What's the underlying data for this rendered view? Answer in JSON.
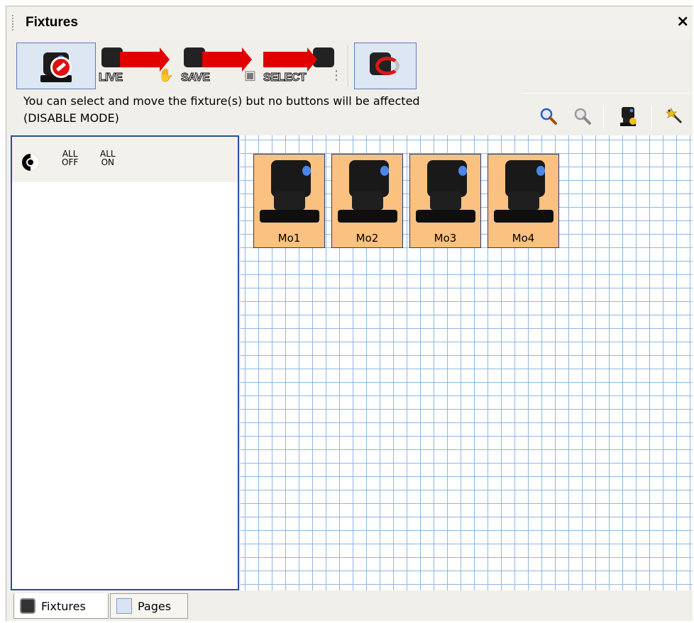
{
  "panel": {
    "title": "Fixtures",
    "close_glyph": "×"
  },
  "toolbar": {
    "buttons": [
      {
        "name": "disable-mode",
        "icon": "fixture-disabled-icon",
        "pressed": true
      },
      {
        "name": "live-mode",
        "icon": "live-mode-icon",
        "word": "LIVE",
        "tag": "hand"
      },
      {
        "name": "save-mode",
        "icon": "save-mode-icon",
        "word": "SAVE",
        "tag": "floppy"
      },
      {
        "name": "select-mode",
        "icon": "select-mode-icon",
        "word": "SELECT",
        "tag": "marquee"
      },
      {
        "name": "magnet-mode",
        "icon": "magnet-icon",
        "pressed": true
      }
    ]
  },
  "info": {
    "line1": "You can select and move the fixture(s) but no buttons will be affected",
    "line2": "(DISABLE MODE)"
  },
  "zoombar": {
    "icons": [
      "zoom-in-icon",
      "zoom-out-icon",
      "add-fixture-icon",
      "magic-wand-icon"
    ]
  },
  "left_pane": {
    "all_off": {
      "top": "ALL",
      "bottom": "OFF"
    },
    "all_on": {
      "top": "ALL",
      "bottom": "ON"
    }
  },
  "fixtures": [
    {
      "label": "Mo1"
    },
    {
      "label": "Mo2"
    },
    {
      "label": "Mo3"
    },
    {
      "label": "Mo4"
    }
  ],
  "tabs": [
    {
      "label": "Fixtures",
      "active": true
    },
    {
      "label": "Pages",
      "active": false
    }
  ],
  "colors": {
    "fixture_fill": "#fbc180",
    "grid_line": "#8fb7e0",
    "pane_border": "#2b4e9e",
    "accent_red": "#e00000"
  }
}
